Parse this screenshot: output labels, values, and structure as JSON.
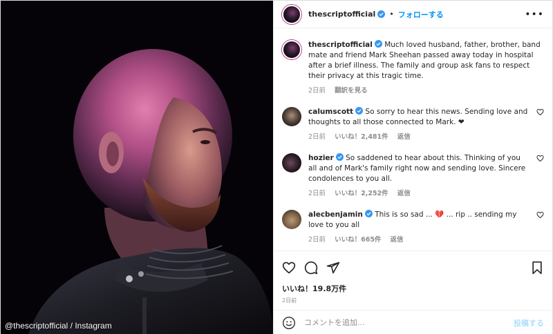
{
  "photo": {
    "credit": "@thescriptofficial / Instagram"
  },
  "header": {
    "username": "thescriptofficial",
    "separator": "•",
    "follow_label": "フォローする",
    "more_label": "•••"
  },
  "caption": {
    "username": "thescriptofficial",
    "text": "Much loved husband, father, brother, band mate and friend Mark Sheehan passed away today in hospital after a brief illness. The family and group ask fans to respect their privacy at this tragic time.",
    "time": "2日前",
    "see_translation": "翻訳を見る"
  },
  "comments": [
    {
      "username": "calumscott",
      "text": "So sorry to hear this news. Sending love and thoughts to all those connected to Mark. ❤",
      "time": "2日前",
      "likes": "いいね！2,481件",
      "reply": "返信"
    },
    {
      "username": "hozier",
      "text": "So saddened to hear about this. Thinking of you all and of Mark's family right now and sending love. Sincere condolences to you all.",
      "time": "2日前",
      "likes": "いいね！2,252件",
      "reply": "返信"
    },
    {
      "username": "alecbenjamin",
      "text": "This is so sad ... 💔 ... rip .. sending my love to you all",
      "time": "2日前",
      "likes": "いいね！665件",
      "reply": "返信"
    }
  ],
  "post": {
    "likes": "いいね！19.8万件",
    "age": "2日前"
  },
  "add_comment": {
    "placeholder": "コメントを追加...",
    "post_label": "投稿する"
  },
  "colors": {
    "accent": "#0095f6",
    "muted": "#8e8e8e",
    "text": "#262626"
  }
}
